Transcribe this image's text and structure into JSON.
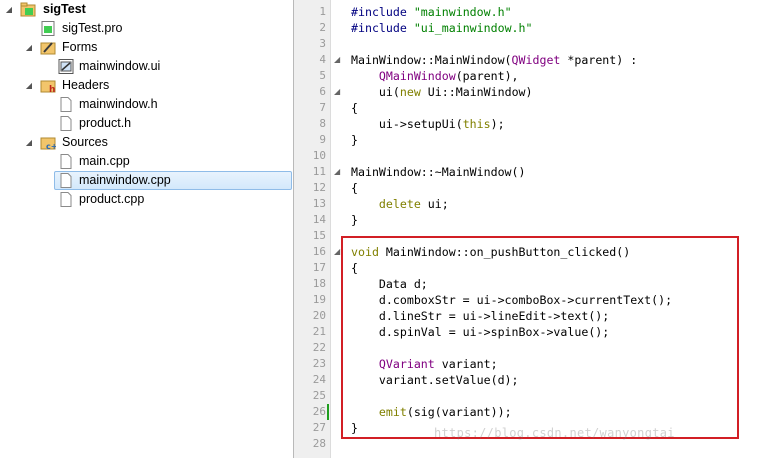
{
  "project_tree": {
    "project_name": "sigTest",
    "pro_file": "sigTest.pro",
    "forms": {
      "label": "Forms",
      "files": [
        "mainwindow.ui"
      ]
    },
    "headers": {
      "label": "Headers",
      "files": [
        "mainwindow.h",
        "product.h"
      ]
    },
    "sources": {
      "label": "Sources",
      "files": [
        "main.cpp",
        "mainwindow.cpp",
        "product.cpp"
      ]
    },
    "selected_file": "mainwindow.cpp"
  },
  "editor": {
    "line_numbers": [
      "1",
      "2",
      "3",
      "4",
      "5",
      "6",
      "7",
      "8",
      "9",
      "10",
      "11",
      "12",
      "13",
      "14",
      "15",
      "16",
      "17",
      "18",
      "19",
      "20",
      "21",
      "22",
      "23",
      "24",
      "25",
      "26",
      "27",
      "28"
    ],
    "lines": [
      "#include \"mainwindow.h\"",
      "#include \"ui_mainwindow.h\"",
      "",
      "MainWindow::MainWindow(QWidget *parent) :",
      "    QMainWindow(parent),",
      "    ui(new Ui::MainWindow)",
      "{",
      "    ui->setupUi(this);",
      "}",
      "",
      "MainWindow::~MainWindow()",
      "{",
      "    delete ui;",
      "}",
      "",
      "void MainWindow::on_pushButton_clicked()",
      "{",
      "    Data d;",
      "    d.comboxStr = ui->comboBox->currentText();",
      "    d.lineStr = ui->lineEdit->text();",
      "    d.spinVal = ui->spinBox->value();",
      "",
      "    QVariant variant;",
      "    variant.setValue(d);",
      "",
      "    emit(sig(variant));",
      "}",
      ""
    ],
    "fold_markers": [
      "4",
      "6",
      "11",
      "16"
    ],
    "highlight_box_color": "#d21f25",
    "watermark": "https://blog.csdn.net/wanyongtai"
  }
}
